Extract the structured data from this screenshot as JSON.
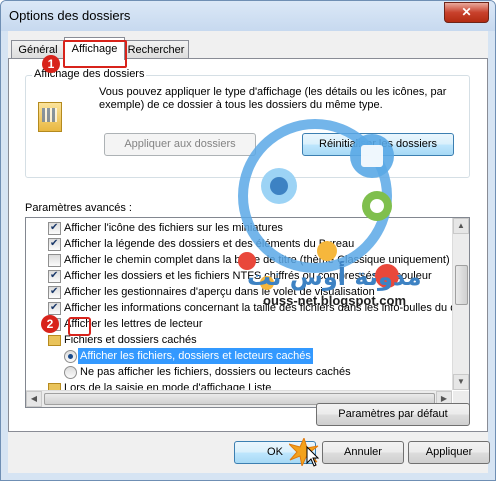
{
  "window": {
    "title": "Options des dossiers",
    "close_glyph": "✕"
  },
  "tabs": [
    {
      "label": "Général",
      "active": false
    },
    {
      "label": "Affichage",
      "active": true
    },
    {
      "label": "Rechercher",
      "active": false
    }
  ],
  "folder_view": {
    "legend": "Affichage des dossiers",
    "description": "Vous pouvez appliquer le type d'affichage (les détails ou les icônes, par exemple) de ce dossier à tous les dossiers du même type.",
    "apply_button": "Appliquer aux dossiers",
    "reset_button": "Réinitialiser les dossiers"
  },
  "advanced": {
    "label": "Paramètres avancés :",
    "items": [
      {
        "type": "checkbox",
        "checked": true,
        "label": "Afficher l'icône des fichiers sur les miniatures"
      },
      {
        "type": "checkbox",
        "checked": true,
        "label": "Afficher la légende des dossiers et des éléments du Bureau"
      },
      {
        "type": "checkbox",
        "checked": false,
        "label": "Afficher le chemin complet dans la barre de titre (thème Classique uniquement)"
      },
      {
        "type": "checkbox",
        "checked": true,
        "label": "Afficher les dossiers et les fichiers NTFS chiffrés ou compressés en couleur"
      },
      {
        "type": "checkbox",
        "checked": true,
        "label": "Afficher les gestionnaires d'aperçu dans le volet de visualisation"
      },
      {
        "type": "checkbox",
        "checked": true,
        "label": "Afficher les informations concernant la taille des fichiers dans les info-bulles du d"
      },
      {
        "type": "checkbox",
        "checked": true,
        "label": "Afficher les lettres de lecteur"
      },
      {
        "type": "folder",
        "label": "Fichiers et dossiers cachés"
      },
      {
        "type": "radio",
        "checked": true,
        "selected": true,
        "label": "Afficher les fichiers, dossiers et lecteurs cachés"
      },
      {
        "type": "radio",
        "checked": false,
        "label": "Ne pas afficher les fichiers, dossiers ou lecteurs cachés"
      },
      {
        "type": "folder",
        "label": "Lors de la saisie en mode d'affichage Liste"
      }
    ],
    "defaults_button": "Paramètres par défaut"
  },
  "footer": {
    "ok": "OK",
    "cancel": "Annuler",
    "apply": "Appliquer"
  },
  "annotations": {
    "badge_1": "1",
    "badge_2": "2",
    "highlight_color": "#d8231b"
  },
  "watermark": {
    "text": "مدونة أوس نت",
    "url": "ouss-net.blogspot.com"
  }
}
